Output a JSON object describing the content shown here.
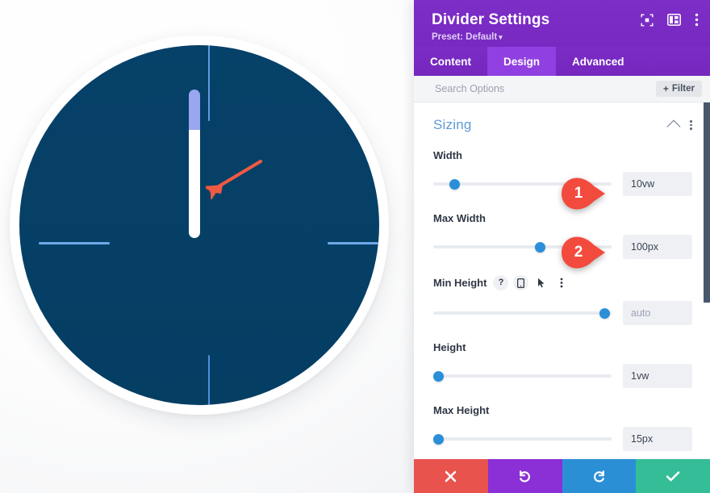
{
  "canvas": {
    "label": "divider-preview-circle",
    "circle_fill": "#05426b",
    "ring_fill": "#ffffff",
    "tick_color": "#6fa8e8",
    "divider": {
      "top_segment_color": "#9aa6f0",
      "bottom_segment_color": "#ffffff"
    },
    "annotation_arrow_color": "#ef5a42"
  },
  "panel": {
    "header": {
      "title": "Divider Settings",
      "preset_label": "Preset: Default",
      "preset_caret": "▾",
      "accent": "#7b2fc4",
      "icons": [
        {
          "name": "expand-icon"
        },
        {
          "name": "layout-toggle-icon"
        },
        {
          "name": "more-options-icon"
        }
      ]
    },
    "tabs": [
      {
        "label": "Content",
        "active": false
      },
      {
        "label": "Design",
        "active": true
      },
      {
        "label": "Advanced",
        "active": false
      }
    ],
    "search": {
      "placeholder": "Search Options",
      "value": "",
      "filter_label": "Filter",
      "filter_plus": "+"
    },
    "sizing": {
      "title": "Sizing",
      "collapse_icon": "chevron-up-icon",
      "options_icon": "more-options-icon",
      "fields": [
        {
          "label": "Width",
          "value": "10vw",
          "placeholder": "",
          "slider_percent": 11,
          "muted": false,
          "icons": []
        },
        {
          "label": "Max Width",
          "value": "100px",
          "placeholder": "",
          "slider_percent": 59,
          "muted": false,
          "icons": []
        },
        {
          "label": "Min Height",
          "value": "",
          "placeholder": "auto",
          "slider_percent": 88,
          "muted": true,
          "icons": [
            "help-icon",
            "responsive-mobile-icon",
            "hover-cursor-icon",
            "more-options-icon"
          ]
        },
        {
          "label": "Height",
          "value": "1vw",
          "placeholder": "",
          "slider_percent": 2,
          "muted": false,
          "icons": []
        },
        {
          "label": "Max Height",
          "value": "15px",
          "placeholder": "",
          "slider_percent": 2,
          "muted": false,
          "icons": []
        }
      ]
    },
    "footer": [
      {
        "name": "cancel-button",
        "glyph": "✕",
        "color": "#e8534e"
      },
      {
        "name": "undo-button",
        "glyph": "↺",
        "color": "#8b2fd6"
      },
      {
        "name": "redo-button",
        "glyph": "↻",
        "color": "#2b8fd6"
      },
      {
        "name": "save-button",
        "glyph": "✓",
        "color": "#35bd97"
      }
    ]
  },
  "callouts": [
    {
      "number": "1",
      "color": "#f24b3e"
    },
    {
      "number": "2",
      "color": "#f24b3e"
    }
  ]
}
